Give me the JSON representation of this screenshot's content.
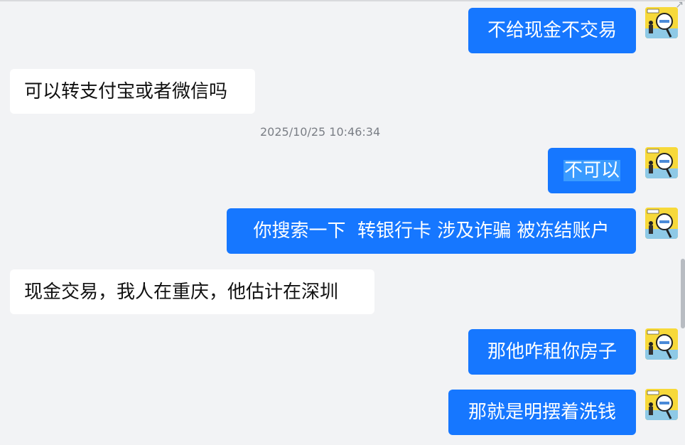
{
  "chat": {
    "timestamp": "2025/10/25 10:46:34",
    "messages": [
      {
        "side": "out",
        "text": "不给现金不交易"
      },
      {
        "side": "in",
        "text": "可以转支付宝或者微信吗"
      },
      {
        "side": "out",
        "text": "不可以",
        "selected": true
      },
      {
        "side": "out",
        "text": "你搜索一下  转银行卡 涉及诈骗 被冻结账户"
      },
      {
        "side": "in",
        "text": "现金交易，我人在重庆，他估计在深圳"
      },
      {
        "side": "out",
        "text": "那他咋租你房子"
      },
      {
        "side": "out",
        "text": "那就是明摆着洗钱"
      }
    ]
  },
  "ui": {
    "corner_icon": "expand-arrow-icon",
    "avatar_icon": "cartoon-magnifier-avatar-icon",
    "colors": {
      "background": "#f2f3f5",
      "outgoing_bubble": "#1677ff",
      "incoming_bubble": "#ffffff",
      "selection": "#3a9bff",
      "timestamp": "#7a7e85"
    }
  }
}
